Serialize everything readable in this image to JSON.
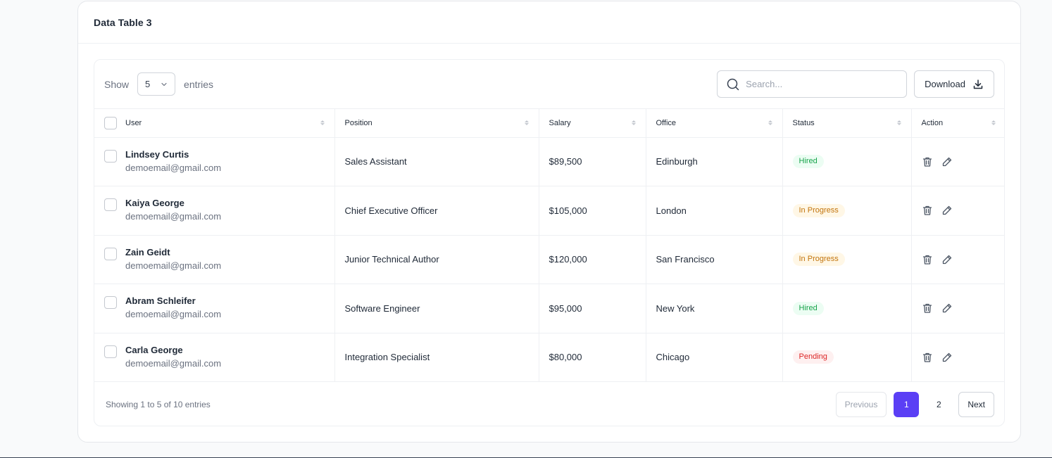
{
  "card": {
    "title": "Data Table 3"
  },
  "toolbar": {
    "show_label": "Show",
    "entries_value": "5",
    "entries_label": "entries",
    "search_placeholder": "Search...",
    "download_label": "Download"
  },
  "columns": [
    "User",
    "Position",
    "Salary",
    "Office",
    "Status",
    "Action"
  ],
  "rows": [
    {
      "name": "Lindsey Curtis",
      "email": "demoemail@gmail.com",
      "position": "Sales Assistant",
      "salary": "$89,500",
      "office": "Edinburgh",
      "status": "Hired",
      "status_type": "hired"
    },
    {
      "name": "Kaiya George",
      "email": "demoemail@gmail.com",
      "position": "Chief Executive Officer",
      "salary": "$105,000",
      "office": "London",
      "status": "In Progress",
      "status_type": "progress"
    },
    {
      "name": "Zain Geidt",
      "email": "demoemail@gmail.com",
      "position": "Junior Technical Author",
      "salary": "$120,000",
      "office": "San Francisco",
      "status": "In Progress",
      "status_type": "progress"
    },
    {
      "name": "Abram Schleifer",
      "email": "demoemail@gmail.com",
      "position": "Software Engineer",
      "salary": "$95,000",
      "office": "New York",
      "status": "Hired",
      "status_type": "hired"
    },
    {
      "name": "Carla George",
      "email": "demoemail@gmail.com",
      "position": "Integration Specialist",
      "salary": "$80,000",
      "office": "Chicago",
      "status": "Pending",
      "status_type": "pending"
    }
  ],
  "footer": {
    "info": "Showing 1 to 5 of 10 entries",
    "previous_label": "Previous",
    "next_label": "Next",
    "pages": [
      "1",
      "2"
    ],
    "current_page": "1"
  },
  "colors": {
    "accent": "#5b3ff5",
    "hired": "#16a34a",
    "in_progress": "#c2740c",
    "pending": "#dc2626"
  },
  "icons": {
    "search": "search-icon",
    "download": "download-icon",
    "select": "chevron-down-icon",
    "sort": "sort-icon",
    "delete": "trash-icon",
    "edit": "pencil-icon"
  }
}
